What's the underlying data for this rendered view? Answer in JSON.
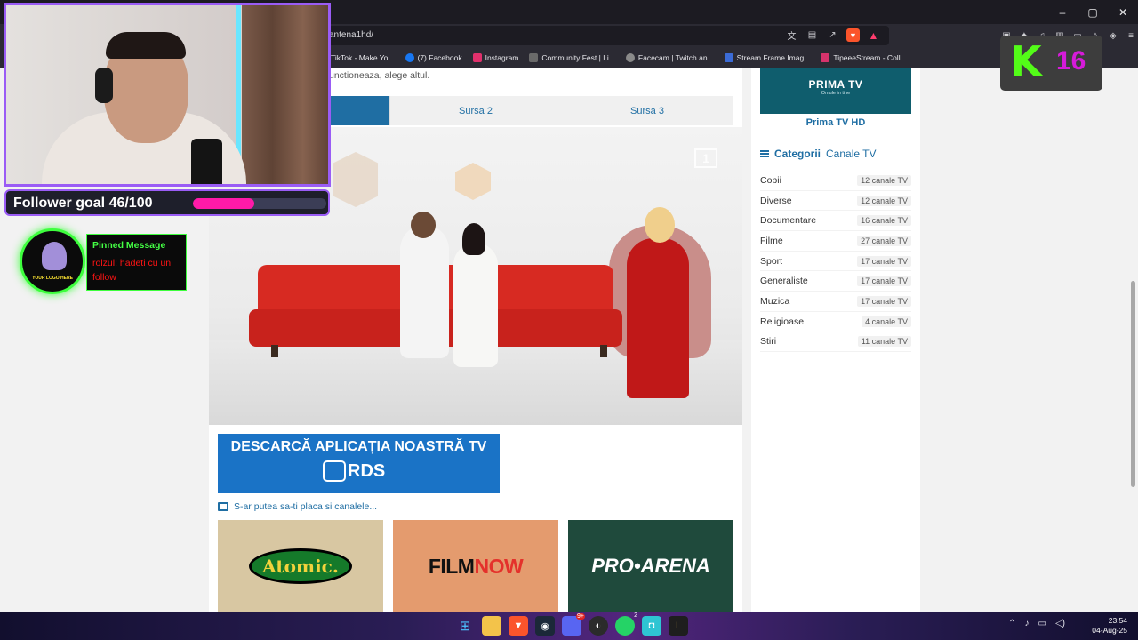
{
  "browser": {
    "url": "antena1hd/",
    "window_controls": [
      "–",
      "▢",
      "✕"
    ],
    "bookmarks": [
      {
        "label": "TikTok - Make Yo...",
        "icon": "tiktok-icon",
        "color": "#111111"
      },
      {
        "label": "(7) Facebook",
        "icon": "facebook-icon",
        "color": "#1877f2"
      },
      {
        "label": "Instagram",
        "icon": "instagram-icon",
        "color": "#e1306c"
      },
      {
        "label": "Community Fest | Li...",
        "icon": "community-icon",
        "color": "#6a6a6a"
      },
      {
        "label": "Facecam | Twitch an...",
        "icon": "globe-icon",
        "color": "#8a8a8a"
      },
      {
        "label": "Stream Frame Imag...",
        "icon": "image-icon",
        "color": "#3b6bd6"
      },
      {
        "label": "TipeeeStream - Coll...",
        "icon": "tipeee-icon",
        "color": "#d6336c"
      }
    ]
  },
  "page": {
    "notice": "unctioneaza, alege altul.",
    "tabs": [
      "Sursa 2",
      "Sursa 3"
    ],
    "banner": {
      "title": "DESCARCĂ APLICAȚIA NOASTRĂ TV",
      "brand": "RDS"
    },
    "suggest_text": "S-ar putea sa-ti placa si canalele...",
    "thumbnails": [
      {
        "label": "Atomic",
        "suffix": ".",
        "icon": "atomic-logo"
      },
      {
        "label_a": "FILM",
        "label_b": "NOW",
        "icon": "filmnow-logo"
      },
      {
        "label": "PRO•ARENA",
        "icon": "proarena-logo"
      }
    ]
  },
  "sidebar": {
    "featured_logo": "PRIMA TV",
    "featured_logo_sub": "Omule in tine",
    "featured_caption": "Prima TV HD",
    "categories_heading_bold": "Categorii",
    "categories_heading_rest": "Canale TV",
    "categories": [
      {
        "name": "Copii",
        "count": "12 canale TV"
      },
      {
        "name": "Diverse",
        "count": "12 canale TV"
      },
      {
        "name": "Documentare",
        "count": "16 canale TV"
      },
      {
        "name": "Filme",
        "count": "27 canale TV"
      },
      {
        "name": "Sport",
        "count": "17 canale TV"
      },
      {
        "name": "Generaliste",
        "count": "17 canale TV"
      },
      {
        "name": "Muzica",
        "count": "17 canale TV"
      },
      {
        "name": "Religioase",
        "count": "4 canale TV"
      },
      {
        "name": "Stiri",
        "count": "11 canale TV"
      }
    ]
  },
  "overlay": {
    "follower_goal": "Follower goal 46/100",
    "follower_progress": 0.46,
    "avatar_text": "YOUR LOGO HERE",
    "pinned_title": "Pinned Message",
    "pinned_message": "rolzul: hadeti cu un follow",
    "kick_letter": "K",
    "kick_viewers": "16"
  },
  "taskbar": {
    "icons": [
      "windows-start-icon",
      "file-explorer-icon",
      "brave-icon",
      "steam-icon",
      "discord-icon",
      "obs-icon",
      "whatsapp-icon",
      "app-icon",
      "league-icon"
    ],
    "discord_badge": "9+",
    "whatsapp_badge": "2",
    "time": "23:54",
    "date": "04-Aug-25"
  },
  "colors": {
    "accent_blue": "#1f6ea3",
    "overlay_purple": "#9a5cf5",
    "overlay_green": "#3dff3d",
    "goal_pink": "#ff1aa8",
    "kick_green": "#53fc18"
  }
}
